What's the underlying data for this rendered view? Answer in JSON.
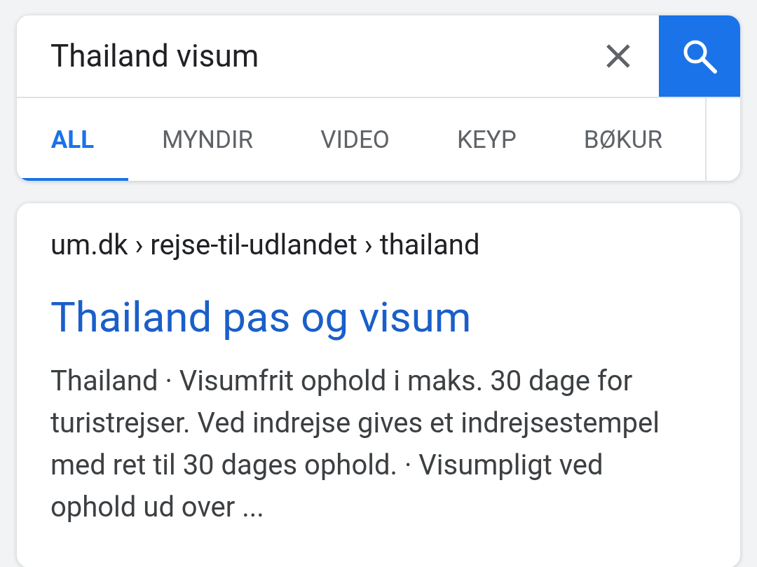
{
  "search": {
    "value": "Thailand visum"
  },
  "tabs": [
    {
      "label": "ALL",
      "selected": true
    },
    {
      "label": "MYNDIR",
      "selected": false
    },
    {
      "label": "VIDEO",
      "selected": false
    },
    {
      "label": "KEYP",
      "selected": false
    },
    {
      "label": "BØKUR",
      "selected": false
    }
  ],
  "result": {
    "breadcrumb": "um.dk › rejse-til-udlandet › thailand",
    "title": "Thailand pas og visum",
    "snippet": "Thailand · Visumfrit ophold i maks. 30 dage for turistrejser. Ved indrejse gives et indrejsestempel med ret til 30 dages ophold. · Visumpligt ved ophold ud over ..."
  }
}
